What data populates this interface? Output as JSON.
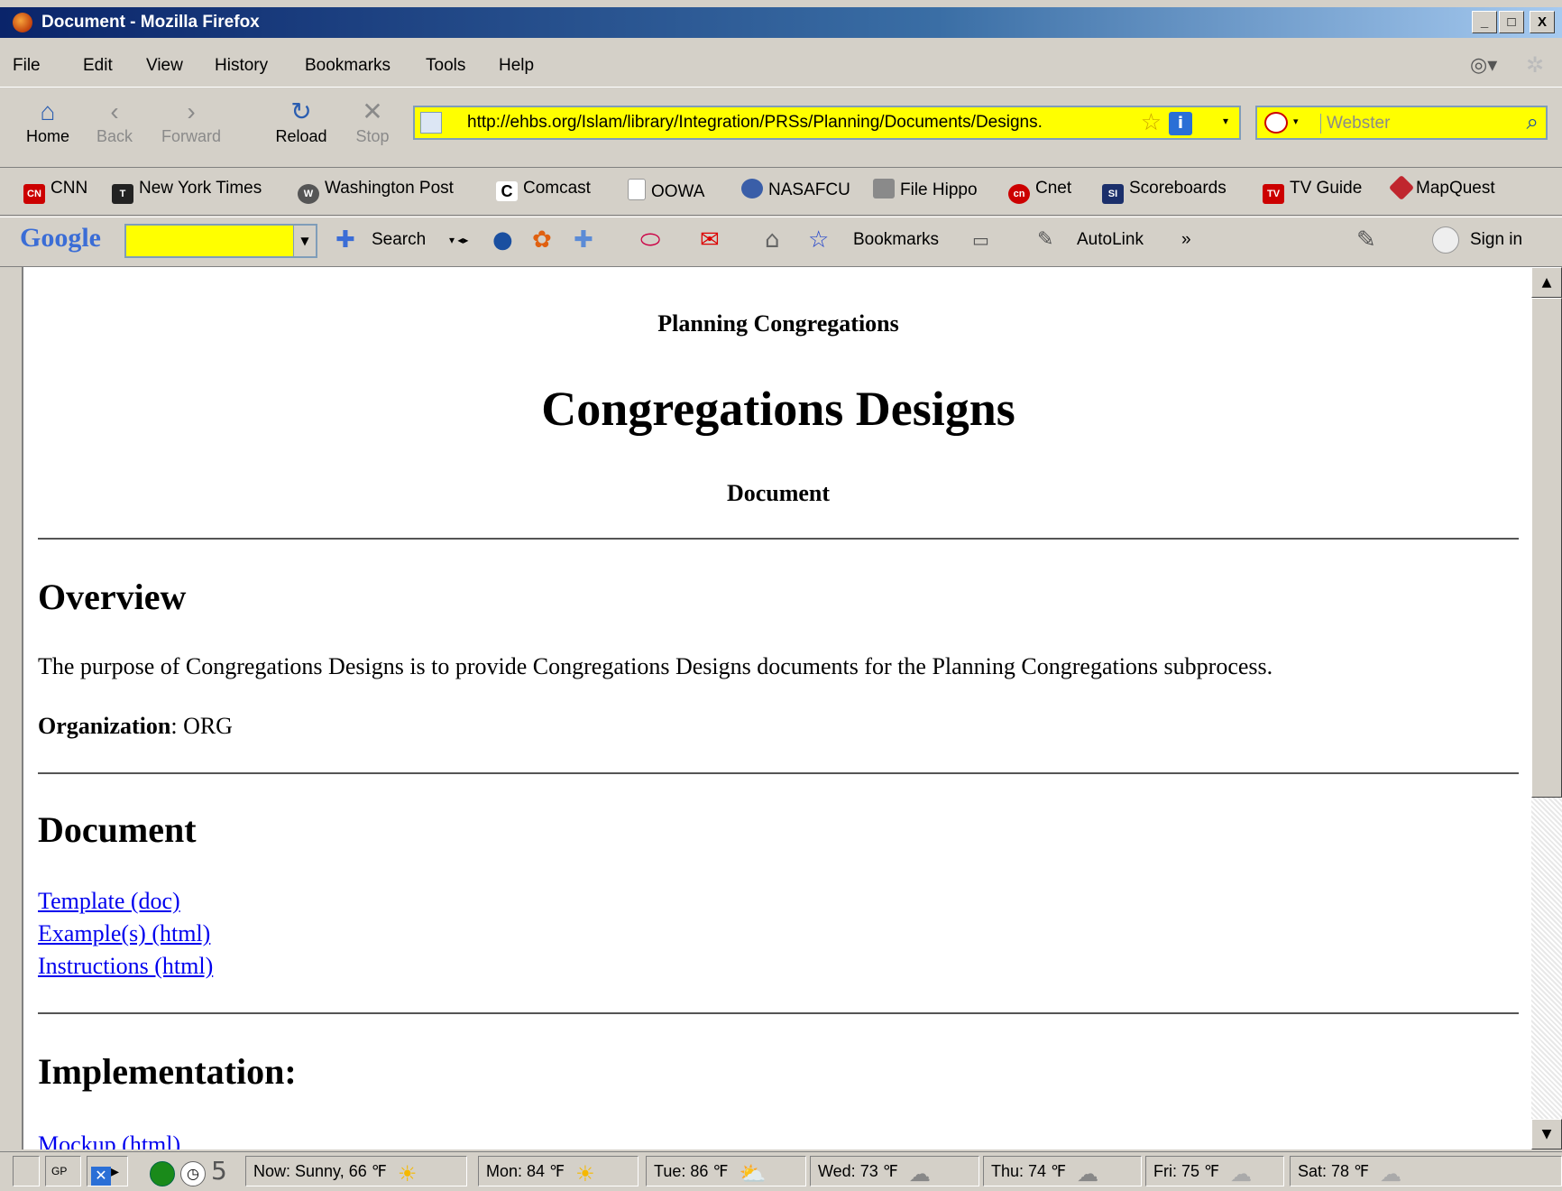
{
  "window": {
    "title": "Document - Mozilla Firefox",
    "controls": {
      "minimize": "_",
      "maximize": "□",
      "close": "X"
    }
  },
  "menu": [
    "File",
    "Edit",
    "View",
    "History",
    "Bookmarks",
    "Tools",
    "Help"
  ],
  "nav": {
    "home": "Home",
    "back": "Back",
    "forward": "Forward",
    "reload": "Reload",
    "stop": "Stop",
    "url": "http://ehbs.org/Islam/library/Integration/PRSs/Planning/Documents/Designs.",
    "search_placeholder": "Webster"
  },
  "bookmarks": [
    "CNN",
    "New York Times",
    "Washington Post",
    "Comcast",
    "OOWA",
    "NASAFCU",
    "File Hippo",
    "Cnet",
    "Scoreboards",
    "TV Guide",
    "MapQuest"
  ],
  "google_toolbar": {
    "logo": "Google",
    "search_label": "Search",
    "bookmarks_label": "Bookmarks",
    "autolink_label": "AutoLink",
    "more": "»",
    "signin_label": "Sign in"
  },
  "page": {
    "subtitle": "Planning Congregations",
    "title": "Congregations Designs",
    "type": "Document",
    "overview": {
      "heading": "Overview",
      "text": "The purpose of Congregations Designs is to provide Congregations Designs documents for the Planning Congregations subprocess.",
      "org_label": "Organization",
      "org_value": ": ORG"
    },
    "document": {
      "heading": "Document",
      "links": [
        "Template (doc)",
        "Example(s) (html)",
        "Instructions (html)"
      ]
    },
    "implementation": {
      "heading": "Implementation:",
      "links": [
        "Mockup (html)"
      ]
    }
  },
  "status": {
    "gp": "GP",
    "count": "5",
    "now": "Now: Sunny, 66 ℉",
    "mon": "Mon: 84 ℉",
    "tue": "Tue: 86 ℉",
    "wed": "Wed: 73 ℉",
    "thu": "Thu: 74 ℉",
    "fri": "Fri: 75 ℉",
    "sat": "Sat: 78 ℉"
  },
  "colors": {
    "url_bg": "#ffff00",
    "link": "#0000ee",
    "title_bar": "#0a246a"
  }
}
